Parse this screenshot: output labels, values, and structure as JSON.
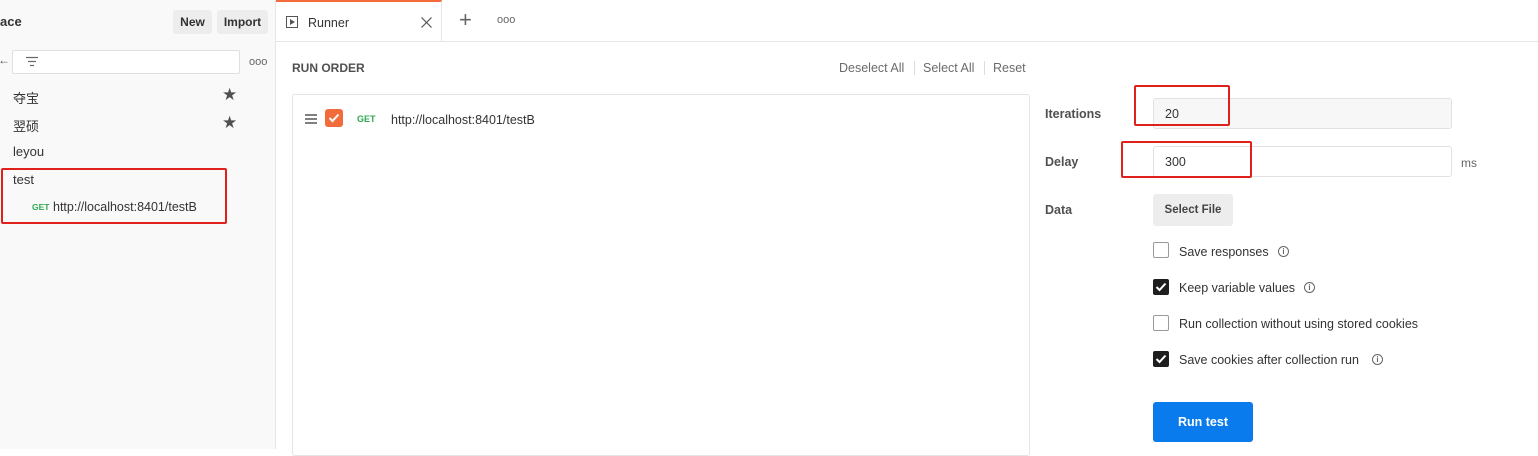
{
  "sidebar": {
    "workspace_label": "ace",
    "new_label": "New",
    "import_label": "Import",
    "collapse_glyph": "←",
    "more_label": "ooo",
    "items": [
      {
        "label": "夺宝",
        "starred": true
      },
      {
        "label": "翌硕",
        "starred": true
      },
      {
        "label": "leyou",
        "starred": false
      },
      {
        "label": "test",
        "starred": false
      }
    ],
    "request": {
      "method": "GET",
      "url": "http://localhost:8401/testB"
    }
  },
  "tabs": {
    "runner_label": "Runner",
    "add_glyph": "+",
    "more_label": "ooo"
  },
  "run_order": {
    "title": "RUN ORDER",
    "deselect_all": "Deselect All",
    "select_all": "Select All",
    "reset": "Reset",
    "items": [
      {
        "checked": true,
        "method": "GET",
        "url": "http://localhost:8401/testB"
      }
    ]
  },
  "settings": {
    "iterations_label": "Iterations",
    "iterations_value": "20",
    "delay_label": "Delay",
    "delay_value": "300",
    "delay_unit": "ms",
    "data_label": "Data",
    "select_file_label": "Select File",
    "options": [
      {
        "label": "Save responses",
        "checked": false,
        "info": true
      },
      {
        "label": "Keep variable values",
        "checked": true,
        "info": true
      },
      {
        "label": "Run collection without using stored cookies",
        "checked": false,
        "info": false
      },
      {
        "label": "Save cookies after collection run",
        "checked": true,
        "info": true
      }
    ],
    "run_label": "Run test"
  },
  "colors": {
    "accent_orange": "#f26b3a",
    "primary_blue": "#097bed",
    "get_green": "#2fa84f",
    "annotation_red": "#e0201a"
  }
}
